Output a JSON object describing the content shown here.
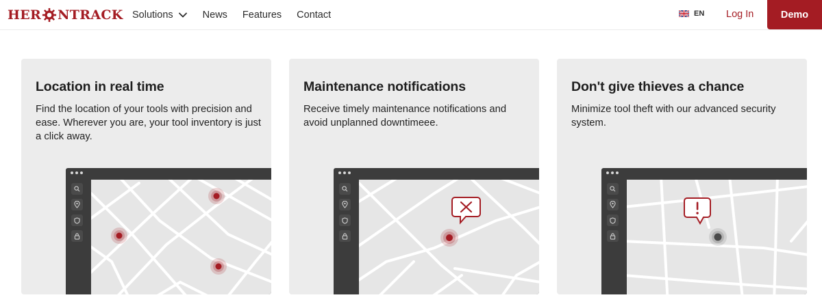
{
  "header": {
    "logo_left": "HER",
    "logo_right": "NTRACK",
    "nav": [
      {
        "label": "Solutions",
        "has_dropdown": true
      },
      {
        "label": "News"
      },
      {
        "label": "Features"
      },
      {
        "label": "Contact"
      }
    ],
    "language": "EN",
    "login_label": "Log In",
    "demo_label": "Demo"
  },
  "colors": {
    "brand_red": "#a41c23",
    "card_bg": "#ececec",
    "window_dark": "#3c3c3c",
    "map_bg": "#e6e6e6",
    "pin_gray": "#5a5a5a"
  },
  "cards": [
    {
      "title": "Location in real time",
      "text": "Find the location of your tools with precision and ease. Wherever you are, your tool inventory is just a click away.",
      "illustration": "map-with-three-red-pins"
    },
    {
      "title": "Maintenance notifications",
      "text": "Receive timely maintenance notifications and avoid unplanned downtimeee.",
      "illustration": "map-with-wrench-notification"
    },
    {
      "title": "Don't give thieves a chance",
      "text": "Minimize tool theft with our advanced security system.",
      "illustration": "map-with-alert-notification"
    }
  ],
  "map_sidebar_icons": [
    "search-icon",
    "location-pin-icon",
    "shield-icon",
    "lock-icon"
  ]
}
